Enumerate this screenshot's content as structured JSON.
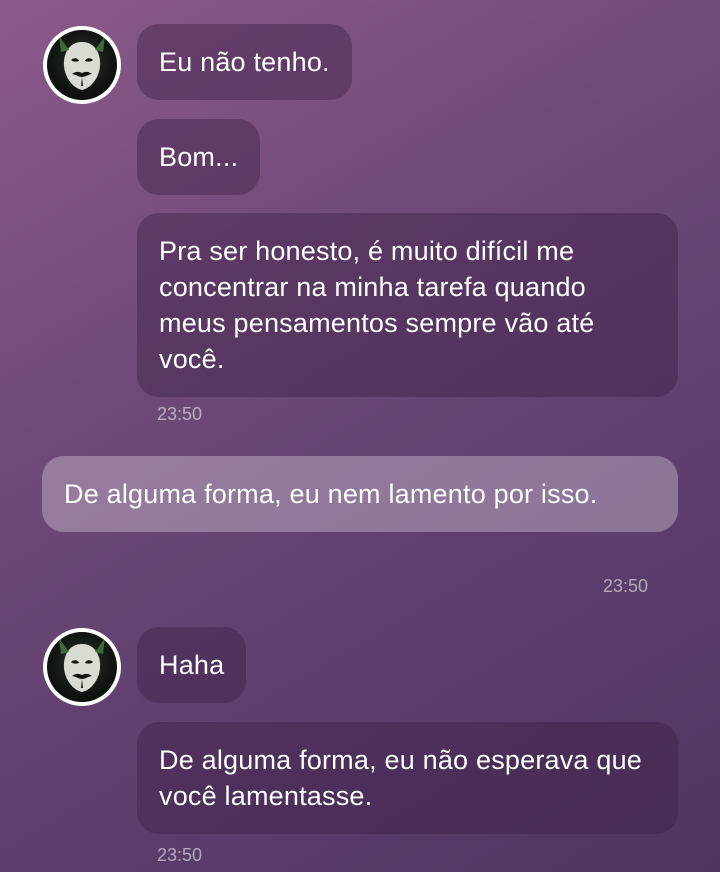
{
  "messages": [
    {
      "text": "Eu não tenho.",
      "direction": "incoming"
    },
    {
      "text": "Bom...",
      "direction": "incoming"
    },
    {
      "text": "Pra ser honesto, é muito difícil me concentrar na minha tarefa quando meus pensamentos sempre vão até você.",
      "direction": "incoming"
    },
    {
      "text": "De alguma forma, eu nem lamento por isso.",
      "direction": "outgoing"
    },
    {
      "text": "Haha",
      "direction": "incoming"
    },
    {
      "text": "De alguma forma, eu não esperava que você lamentasse.",
      "direction": "incoming"
    }
  ],
  "timestamps": [
    "23:50",
    "23:50",
    "23:50"
  ],
  "avatar": {
    "icon": "mask-avatar-icon"
  },
  "colors": {
    "incoming_bubble": "#4e3259",
    "outgoing_bubble": "#a892ad",
    "text": "#ffffff"
  }
}
